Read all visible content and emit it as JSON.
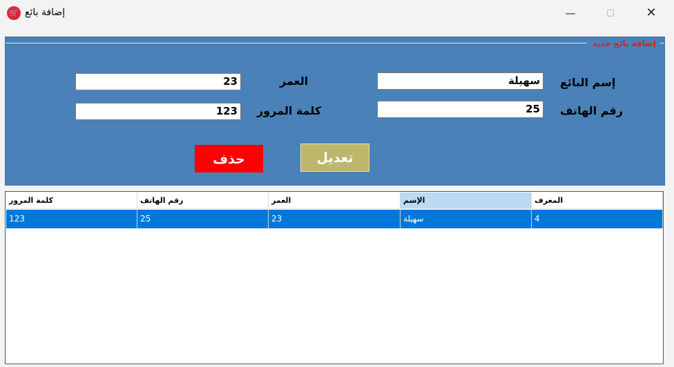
{
  "window": {
    "title": "إضافة بائع",
    "icon": "shopping-cart-icon",
    "minimize": "—",
    "maximize": "▢",
    "close": "✕"
  },
  "form": {
    "group_title": "إضافة بائع جديد",
    "seller_name_label": "إسم البائع",
    "seller_name_value": "سهيلة",
    "age_label": "العمر",
    "age_value": "23",
    "phone_label": "رقم الهاتف",
    "phone_value": "25",
    "password_label": "كلمة المرور",
    "password_value": "123",
    "edit_button": "تعديل",
    "delete_button": "حذف"
  },
  "table": {
    "columns": [
      "كلمة المرور",
      "رقم الهاتف",
      "العمر",
      "الإسم",
      "المعرف"
    ],
    "rows": [
      [
        "123",
        "25",
        "23",
        "سهيلة",
        "4"
      ]
    ]
  },
  "colors": {
    "panel": "#4a81b8",
    "delete": "#ff0000",
    "edit": "#bdb76b",
    "selection": "#0078d7",
    "caption": "#e02020"
  }
}
